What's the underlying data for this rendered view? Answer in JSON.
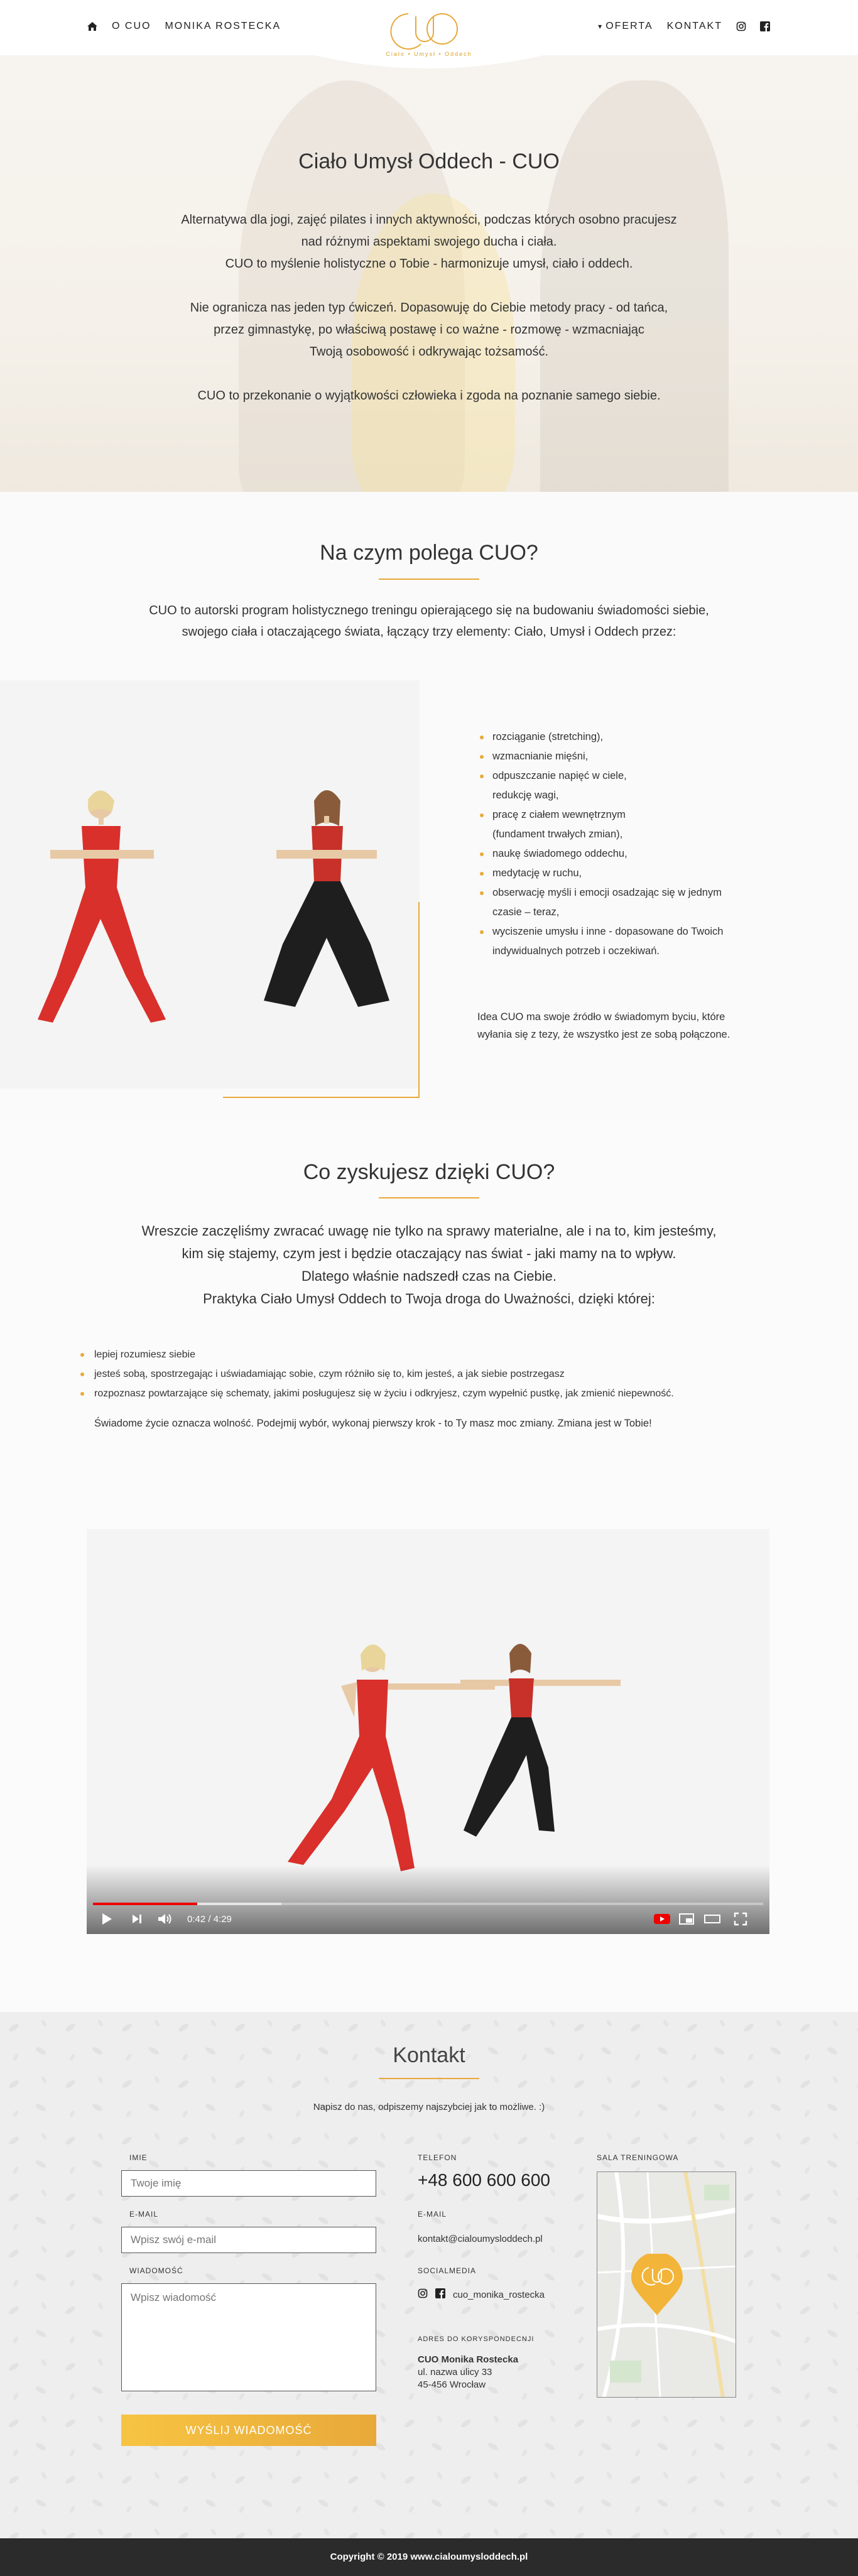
{
  "header": {
    "nav_left": [
      "O CUO",
      "MONIKA ROSTECKA"
    ],
    "nav_right": [
      "OFERTA",
      "KONTAKT"
    ],
    "logo_tagline": "Ciało • Umysł • Oddech",
    "brand_color": "#e8a93a"
  },
  "hero": {
    "title": "Ciało Umysł Oddech - CUO",
    "paragraphs": [
      [
        "Alternatywa dla jogi, zajęć pilates i innych aktywności, podczas których osobno pracujesz",
        "nad różnymi aspektami swojego ducha i ciała.",
        "CUO to myślenie holistyczne o Tobie - harmonizuje umysł, ciało i oddech."
      ],
      [
        "Nie ogranicza nas jeden typ ćwiczeń. Dopasowuję do Ciebie metody pracy - od tańca,",
        "przez gimnastykę, po właściwą postawę i co ważne - rozmowę - wzmacniając",
        "Twoją osobowość i odkrywając tożsamość."
      ],
      [
        "CUO to przekonanie o wyjątkowości człowieka i zgoda na poznanie samego siebie."
      ]
    ]
  },
  "section_what": {
    "title": "Na czym polega CUO?",
    "intro": [
      "CUO to autorski program holistycznego treningu opierającego się na budowaniu świadomości siebie,",
      "swojego ciała i otaczającego świata, łączący trzy elementy: Ciało, Umysł i Oddech przez:"
    ],
    "items": [
      [
        "rozciąganie (stretching),"
      ],
      [
        "wzmacnianie mięśni,"
      ],
      [
        "odpuszczanie napięć w ciele,",
        "redukcję wagi,"
      ],
      [
        "pracę z ciałem wewnętrznym",
        "(fundament trwałych zmian),"
      ],
      [
        "naukę świadomego oddechu,"
      ],
      [
        "medytację w ruchu,"
      ],
      [
        "obserwację myśli i emocji osadzając się w jednym",
        "czasie – teraz,"
      ],
      [
        "wyciszenie umysłu i inne - dopasowane do Twoich",
        "indywidualnych potrzeb i oczekiwań."
      ]
    ],
    "outro": [
      "Idea CUO ma swoje źródło w świadomym byciu, które",
      "wyłania się z tezy, że wszystko jest ze sobą połączone."
    ]
  },
  "section_gain": {
    "title": "Co zyskujesz dzięki CUO?",
    "intro": [
      "Wreszcie zaczęliśmy zwracać uwagę nie tylko na sprawy materialne, ale i na to, kim jesteśmy,",
      "kim się stajemy, czym jest i będzie otaczający nas świat - jaki mamy na to wpływ.",
      "Dlatego właśnie nadszedł czas na Ciebie.",
      "Praktyka Ciało Umysł Oddech to Twoja droga do Uważności, dzięki której:"
    ],
    "items": [
      "lepiej rozumiesz siebie",
      "jesteś sobą, spostrzegając i uświadamiając sobie, czym różniło się to, kim jesteś, a jak siebie postrzegasz",
      "rozpoznasz powtarzające się schematy, jakimi posługujesz się w życiu i odkryjesz, czym wypełnić pustkę, jak zmienić niepewność."
    ],
    "outro": "Świadome życie oznacza wolność. Podejmij wybór, wykonaj pierwszy krok - to Ty masz moc zmiany. Zmiana jest w Tobie!"
  },
  "video": {
    "time": "0:42 / 4:29",
    "progress": 0.156
  },
  "contact": {
    "title": "Kontakt",
    "subtitle": "Napisz do nas, odpiszemy najszybciej jak to możliwe. :)",
    "name_label": "IMIE",
    "name_placeholder": "Twoje imię",
    "email_label": "E-MAIL",
    "email_placeholder": "Wpisz swój e-mail",
    "message_label": "WIADOMOŚĆ",
    "message_placeholder": "Wpisz wiadomość",
    "send_label": "WYŚLIJ WIADOMOŚĆ",
    "phone_label": "TELEFON",
    "phone": "+48 600 600 600",
    "email_label2": "E-MAIL",
    "email": "kontakt@cialoumysloddech.pl",
    "social_label": "SOCIALMEDIA",
    "instagram": "cuo_monika_rostecka",
    "address_label": "ADRES DO KORYSPONDECNJI",
    "address_name": "CUO Monika Rostecka",
    "address_street": "ul. nazwa ulicy 33",
    "address_city": "45-456 Wrocław",
    "map_label": "SALA TRENINGOWA"
  },
  "footer": {
    "copyright": "Copyright © 2019 www.cialoumysloddech.pl"
  }
}
